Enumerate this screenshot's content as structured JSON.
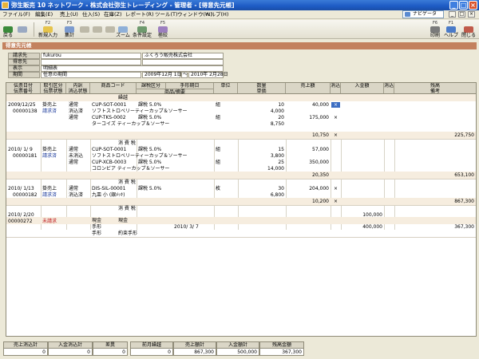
{
  "window": {
    "title": "弥生販売 10 ネットワーク - 株式会社弥生トレーディング - 管理者 - [得意先元帳]",
    "min": "_",
    "max": "□",
    "close": "×"
  },
  "menu": {
    "items": [
      "ファイル(F)",
      "編集(E)",
      "売上(U)",
      "仕入(S)",
      "在庫(Z)",
      "レポート(R)",
      "ツール(T)",
      "ウィンドウ(W)",
      "ヘルプ(H)"
    ],
    "navigator": "ナビゲータ"
  },
  "toolbar": {
    "back_label": "戻る",
    "forward_label": "",
    "new_key": "F2",
    "new_label": "新規入力",
    "total_key": "F3",
    "total_label": "集計",
    "zoom_label": "ズーム",
    "condition_key": "F4",
    "condition_label": "条件設定",
    "narrow_key": "F5",
    "narrow_label": "極絞",
    "print_key": "F6",
    "print_label": "印刷",
    "help_key": "F1",
    "help_label": "ヘルプ",
    "close_label": "閉じる"
  },
  "page": {
    "header": "得意先元帳"
  },
  "info": {
    "billing_label": "請求先",
    "billing_code": "fukurou",
    "billing_name": "ふくろう販売株式会社",
    "customer_label": "得意先",
    "display_label": "表示",
    "display_value": "明細表",
    "period_label": "期間",
    "period_type": "任意の期間",
    "period_from": "2009年12月 1日",
    "period_sep": "～",
    "period_to": "2010年 2月28日"
  },
  "ledger": {
    "headers": {
      "date": "伝票日付",
      "slip_no": "伝票番号",
      "trade_type": "取引区分",
      "slip_status": "伝票状態",
      "detail": "内訳",
      "clear_status": "消込状態",
      "product_code": "商品コード",
      "tax_class": "課税区分",
      "product_name": "商品/摘要",
      "due_date": "手形期日",
      "unit": "単位",
      "quantity": "数量",
      "unit_price": "単価",
      "sales_amount": "売上額",
      "cleared": "消込",
      "payment_amount": "入金額",
      "cleared2": "消込",
      "balance": "残高",
      "remarks": "備考"
    },
    "rows": {
      "carry": "繰越",
      "s1_date": "2009/12/25",
      "s1_no": "00000138",
      "s1_type": "掛売上",
      "s1_state": "請求済",
      "s1_kind1": "通常",
      "s1_kind2": "消込済",
      "s1_kind3": "通常",
      "l1_code": "CUP-SOT-0001",
      "l1_tax": "課税 5.0%",
      "l1_name": "ソフトストロベリーティーカップ＆ソーサー",
      "l1_unit": "組",
      "l1_qty": "10",
      "l1_price": "4,000",
      "l1_sales": "40,000",
      "l1_mark": "×",
      "l2_code": "CUP-TKS-0002",
      "l2_tax": "課税 5.0%",
      "l2_name": "ターコイズ ティーカップ＆ソーサー",
      "l2_unit": "組",
      "l2_qty": "20",
      "l2_price": "8,750",
      "l2_sales": "175,000",
      "l2_mark": "×",
      "s1_tax_sales": "10,750",
      "s1_tax_mark": "×",
      "s1_balance": "225,750",
      "tax_label": "消 費 税",
      "s2_date": "2010/ 1/ 9",
      "s2_no": "00000181",
      "s2_type": "掛売上",
      "s2_state": "請求済",
      "s2_kind1": "通常",
      "s2_kind2": "未消込",
      "s2_kind3": "通常",
      "l3_code": "CUP-SOT-0001",
      "l3_tax": "課税 5.0%",
      "l3_name": "ソフトストロベリーティーカップ＆ソーサー",
      "l3_unit": "組",
      "l3_qty": "15",
      "l3_price": "3,800",
      "l3_sales": "57,000",
      "l4_code": "CUP-XCB-0003",
      "l4_tax": "課税 5.0%",
      "l4_name": "コロンビア ティーカップ＆ソーサー",
      "l4_unit": "組",
      "l4_qty": "25",
      "l4_price": "14,000",
      "l4_sales": "350,000",
      "s2_tax_sales": "20,350",
      "s2_balance": "653,100",
      "s3_date": "2010/ 1/13",
      "s3_no": "00000182",
      "s3_type": "掛売上",
      "s3_state": "請求済",
      "s3_kind1": "通常",
      "s3_kind2": "消込済",
      "l5_code": "DIS-SIL-00001",
      "l5_tax": "課税 5.0%",
      "l5_name": "九皿 小 (銀ﾒｯｷ)",
      "l5_unit": "枚",
      "l5_qty": "30",
      "l5_price": "6,800",
      "l5_sales": "204,000",
      "l5_mark": "×",
      "s3_tax_sales": "10,200",
      "s3_tax_mark": "×",
      "s3_balance": "867,300",
      "s4_date": "2010/ 2/20",
      "s4_no": "00000272",
      "s4_state": "未請求",
      "s4_cash": "現金",
      "s4_cash2": "現金",
      "s4_cash_amount": "100,000",
      "s4_bill": "手形",
      "s4_bill_due": "2010/ 3/ 7",
      "s4_bill_name": "約束手形",
      "s4_bill_amount": "400,000",
      "s4_balance": "367,300"
    }
  },
  "totals": {
    "left": [
      {
        "label": "売上消込計",
        "value": "0"
      },
      {
        "label": "入金消込計",
        "value": "0"
      },
      {
        "label": "差異",
        "value": "0"
      }
    ],
    "right": [
      {
        "label": "前月繰越",
        "value": "0"
      },
      {
        "label": "売上額計",
        "value": "867,300"
      },
      {
        "label": "入金額計",
        "value": "500,000"
      },
      {
        "label": "残高金額",
        "value": "367,300"
      }
    ]
  },
  "colors": {
    "header_strip": "#c3815e",
    "title_bar": "#1d5bc4",
    "row_band": "#f6eddf",
    "selection": "#3d6ec2"
  }
}
